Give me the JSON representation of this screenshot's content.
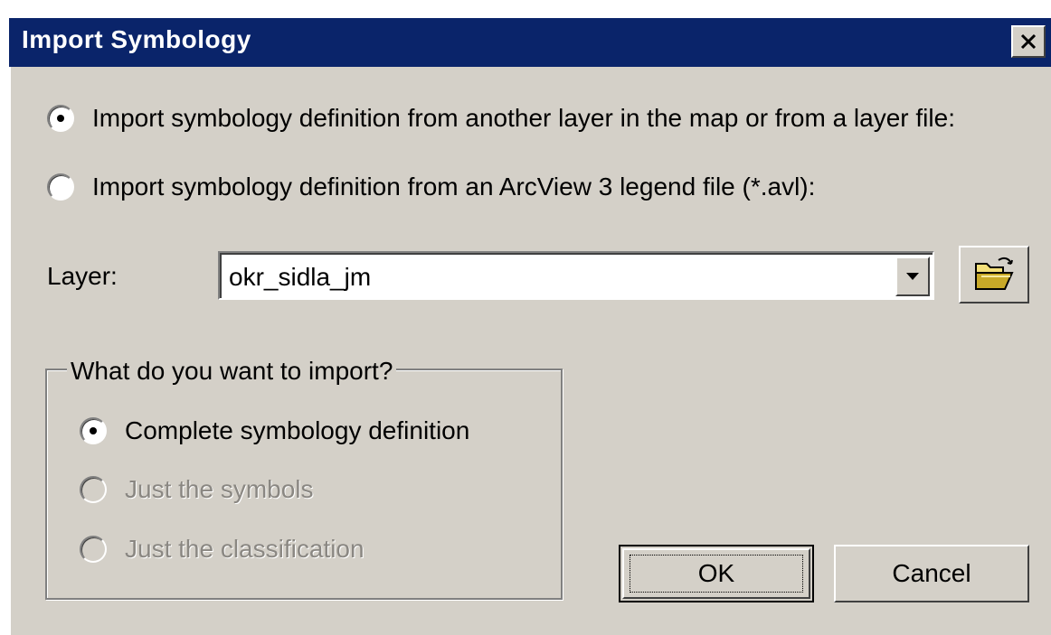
{
  "dialog": {
    "title": "Import Symbology",
    "close_label": "X"
  },
  "source_options": [
    {
      "label": "Import symbology definition from another layer in the map or from a layer file:",
      "checked": true
    },
    {
      "label": "Import symbology definition from an ArcView 3 legend file (*.avl):",
      "checked": false
    }
  ],
  "layer": {
    "label": "Layer:",
    "value": "okr_sidla_jm"
  },
  "import_group": {
    "legend": "What do you want to import?",
    "options": [
      {
        "label": "Complete symbology definition",
        "checked": true,
        "enabled": true
      },
      {
        "label": "Just the symbols",
        "checked": false,
        "enabled": false
      },
      {
        "label": "Just the classification",
        "checked": false,
        "enabled": false
      }
    ]
  },
  "buttons": {
    "ok": "OK",
    "cancel": "Cancel"
  },
  "icons": {
    "open": "folder-open-icon",
    "dropdown": "chevron-down-icon",
    "close": "close-icon"
  },
  "colors": {
    "titlebar": "#0a246a",
    "face": "#d4d0c8"
  }
}
